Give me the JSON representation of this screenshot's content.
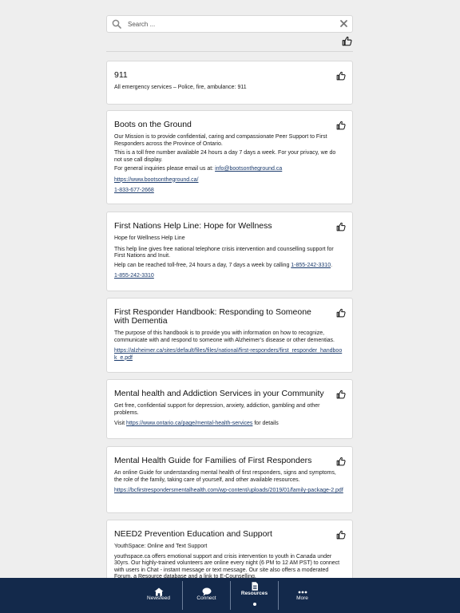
{
  "search": {
    "placeholder": "Search ..."
  },
  "cards": [
    {
      "title": "911",
      "lines": [
        "All emergency services – Police, fire, ambulance: 911"
      ]
    },
    {
      "title": "Boots on the Ground",
      "lines": [
        "Our Mission is to provide confidential, caring and compassionate Peer Support to First Responders across the Province of Ontario.",
        "This is a toll free number available 24 hours a day 7 days a week. For your privacy, we do not use call display.",
        "For general inquiries please email us at: "
      ],
      "email": "info@bootsontheground.ca",
      "links": [
        "https://www.bootsontheground.ca/",
        "1-833-677-2668"
      ]
    },
    {
      "title": "First Nations Help Line: Hope for Wellness",
      "lines": [
        "Hope for Wellness Help Line",
        "This help line gives free national telephone crisis intervention and counselling support for First Nations and Inuit.",
        "Help can be reached toll-free, 24 hours a day, 7 days a week by calling "
      ],
      "inline_phone": "1-855-242-3310",
      "inline_suffix": ".",
      "links": [
        "1-855-242-3310"
      ]
    },
    {
      "title": "First Responder Handbook: Responding to Someone with Dementia",
      "lines": [
        "The purpose of this handbook is to provide you with information on how to recognize, communicate with and respond to someone with Alzheimer’s disease or other dementias."
      ],
      "links": [
        "https://alzheimer.ca/sites/default/files/files/national/first-responders/first_responder_handbook_e.pdf"
      ]
    },
    {
      "title": "Mental health and Addiction Services in your Community",
      "lines": [
        "Get free, confidential support for depression, anxiety, addiction, gambling and other problems."
      ],
      "visit_prefix": "Visit ",
      "visit_link": "https://www.ontario.ca/page/mental-health-services",
      "visit_suffix": " for details"
    },
    {
      "title": "Mental Health Guide for Families of First Responders",
      "lines": [
        "An online Guide for understanding mental health of first responders, signs and symptoms, the role of the family, taking care of yourself, and other available resources."
      ],
      "links": [
        "https://bcfirstrespondersmentalhealth.com/wp-content/uploads/2019/01/family-package-2.pdf"
      ]
    },
    {
      "title": "NEED2 Prevention Education and Support",
      "lines": [
        "YouthSpace: Online and Text Support",
        "youthspace.ca offers emotional support and crisis intervention to youth in Canada under 30yrs. Our highly-trained volunteers are online every night (6 PM to 12 AM PST) to connect with users in Chat - instant message or text message. Our site also offers a moderated Forum, a Resource database and a link to E-Counselling."
      ]
    }
  ],
  "nav": [
    {
      "label": "Newsfeed",
      "icon": "newspaper-icon"
    },
    {
      "label": "Connect",
      "icon": "chat-bubble-icon"
    },
    {
      "label": "Resources",
      "icon": "document-icon",
      "active": true
    },
    {
      "label": "More",
      "icon": "more-dots-icon"
    }
  ],
  "colors": {
    "navbar": "#13294b",
    "link": "#1a3a6c",
    "background": "#eeeeee"
  }
}
